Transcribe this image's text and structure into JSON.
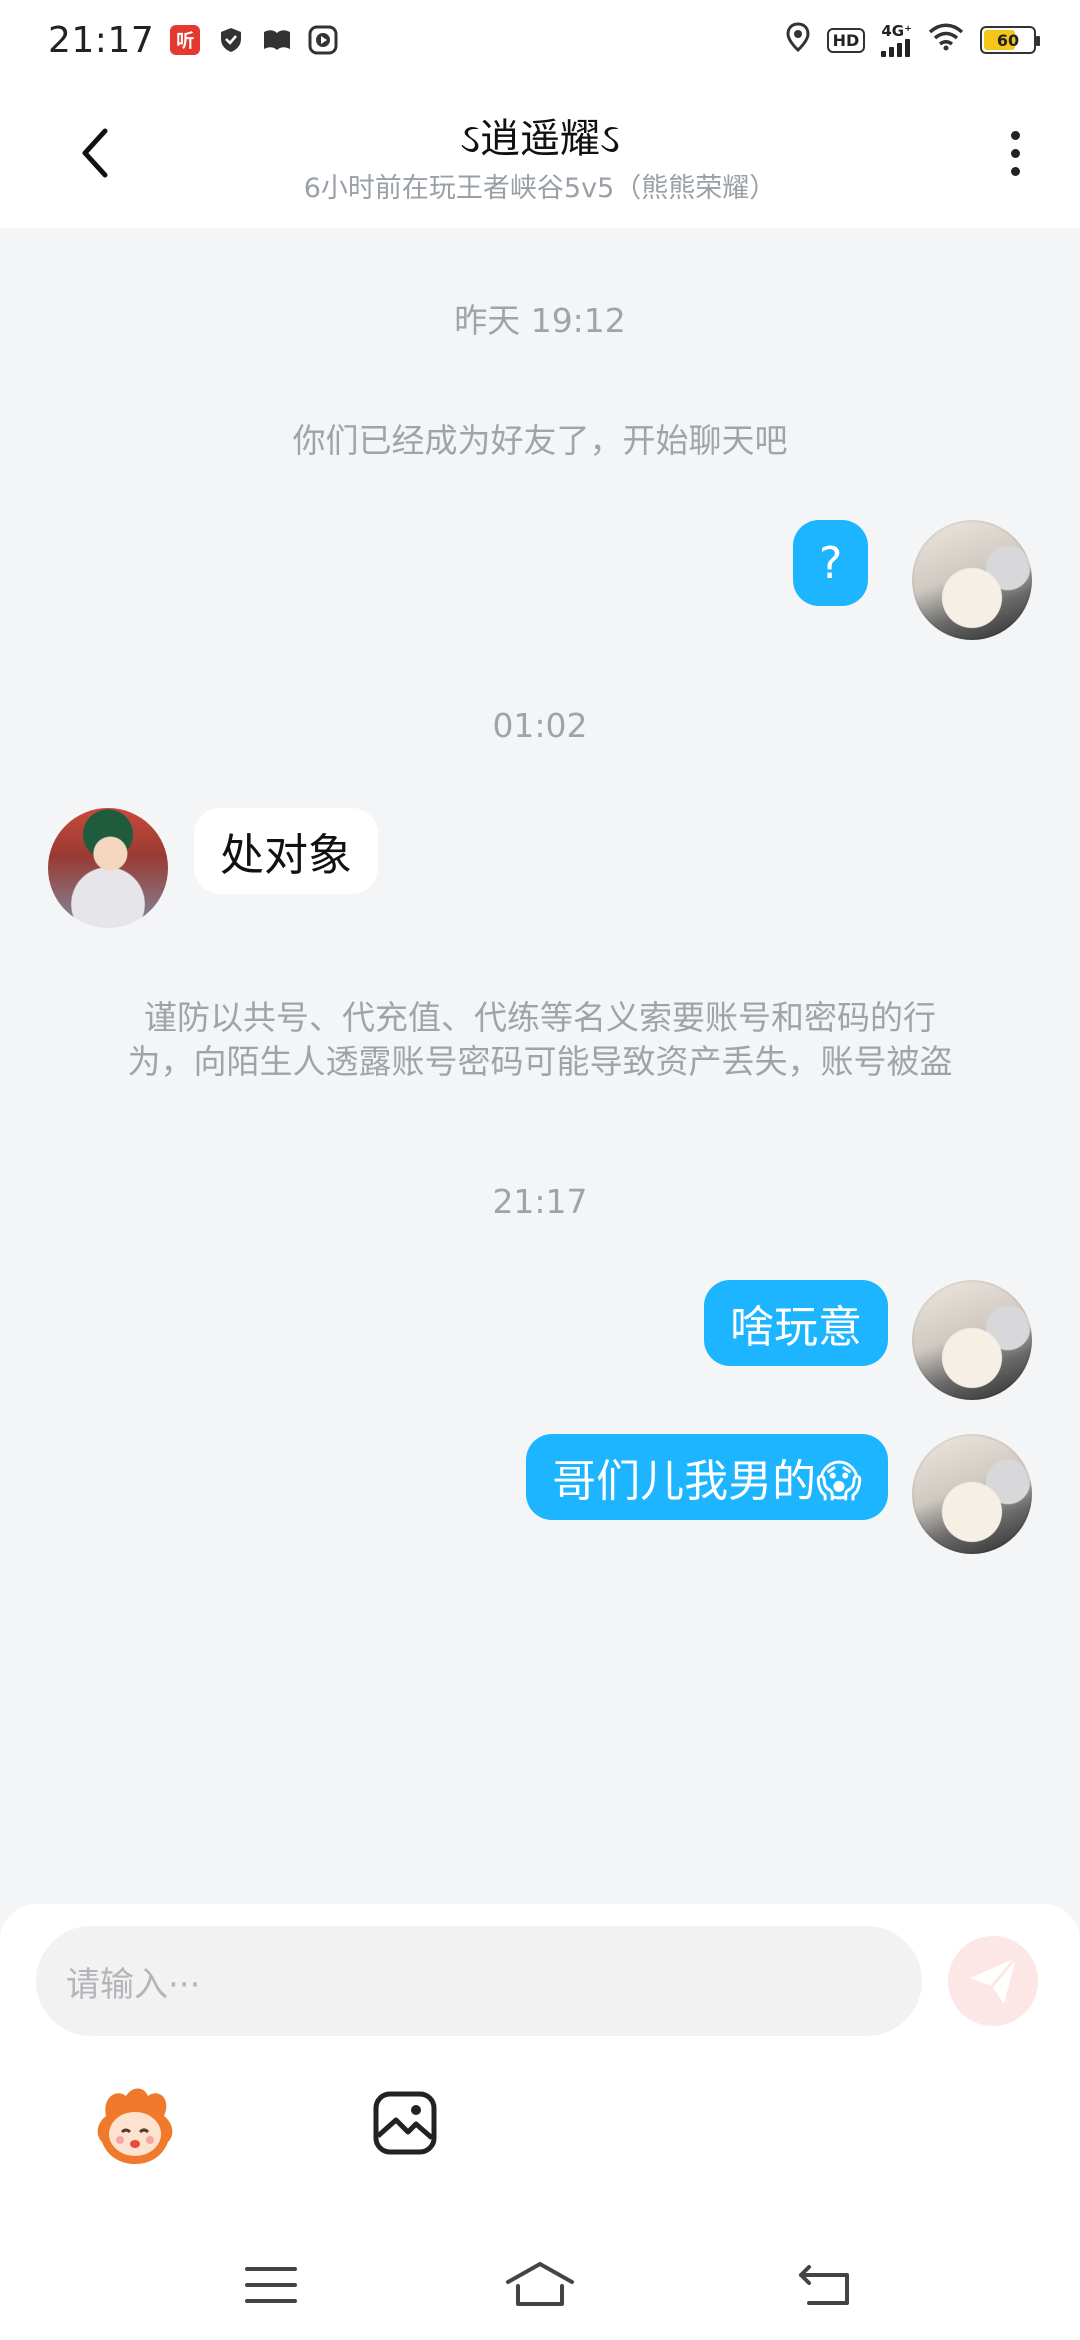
{
  "status_bar": {
    "time": "21:17",
    "app_icon_text": "听",
    "network": "4G⁺",
    "hd": "HD",
    "battery": "60"
  },
  "header": {
    "title": "ઽ逍遥耀ઽ",
    "subtitle": "6小时前在玩王者峡谷5v5（熊熊荣耀）"
  },
  "chat": {
    "timestamps": [
      "昨天 19:12",
      "01:02",
      "21:17"
    ],
    "system_friend_notice": "你们已经成为好友了，开始聊天吧",
    "security_notice_line1": "谨防以共号、代充值、代练等名义索要账号和密码的行",
    "security_notice_line2": "为，向陌生人透露账号密码可能导致资产丢失，账号被盗",
    "messages": [
      {
        "side": "out",
        "text": "?"
      },
      {
        "side": "in",
        "text": "处对象"
      },
      {
        "side": "out",
        "text": "啥玩意"
      },
      {
        "side": "out",
        "text": "哥们儿我男的😱"
      }
    ]
  },
  "input": {
    "placeholder": "请输入···"
  },
  "colors": {
    "bubble_out": "#1db5ff",
    "background": "#f4f5f7",
    "send_button": "#fde6e6"
  },
  "icons": [
    "back-icon",
    "more-icon",
    "send-icon",
    "emoji-icon",
    "image-icon",
    "menu-icon",
    "home-icon",
    "return-icon"
  ]
}
